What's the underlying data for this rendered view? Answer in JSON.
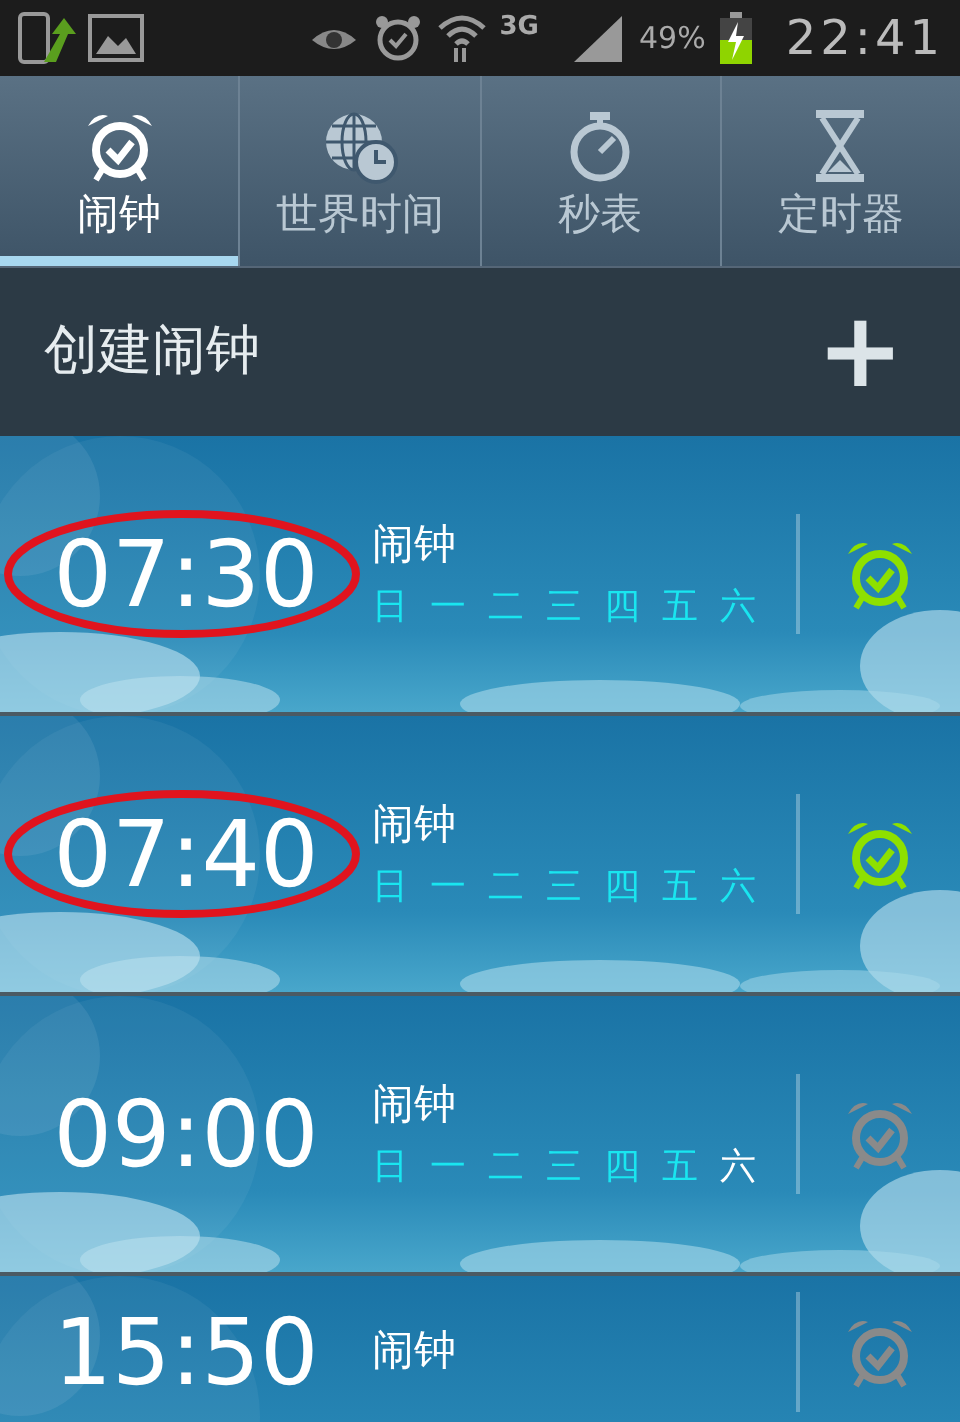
{
  "status_bar": {
    "network": "3G",
    "battery": "49%",
    "time": "22:41"
  },
  "tabs": [
    {
      "kind": "alarm",
      "label": "闹钟",
      "selected": true
    },
    {
      "kind": "world",
      "label": "世界时间",
      "selected": false
    },
    {
      "kind": "stopwatch",
      "label": "秒表",
      "selected": false
    },
    {
      "kind": "timer",
      "label": "定时器",
      "selected": false
    }
  ],
  "create_bar": {
    "label": "创建闹钟",
    "button": "+"
  },
  "alarms": [
    {
      "time": "07:30",
      "name": "闹钟",
      "on": true,
      "circled": true,
      "days": [
        {
          "label": "日",
          "selected": true
        },
        {
          "label": "一",
          "selected": true
        },
        {
          "label": "二",
          "selected": true
        },
        {
          "label": "三",
          "selected": true
        },
        {
          "label": "四",
          "selected": true
        },
        {
          "label": "五",
          "selected": true
        },
        {
          "label": "六",
          "selected": true
        }
      ]
    },
    {
      "time": "07:40",
      "name": "闹钟",
      "on": true,
      "circled": true,
      "days": [
        {
          "label": "日",
          "selected": true
        },
        {
          "label": "一",
          "selected": true
        },
        {
          "label": "二",
          "selected": true
        },
        {
          "label": "三",
          "selected": true
        },
        {
          "label": "四",
          "selected": true
        },
        {
          "label": "五",
          "selected": true
        },
        {
          "label": "六",
          "selected": true
        }
      ]
    },
    {
      "time": "09:00",
      "name": "闹钟",
      "on": false,
      "circled": false,
      "days": [
        {
          "label": "日",
          "selected": true
        },
        {
          "label": "一",
          "selected": true
        },
        {
          "label": "二",
          "selected": true
        },
        {
          "label": "三",
          "selected": true
        },
        {
          "label": "四",
          "selected": true
        },
        {
          "label": "五",
          "selected": true
        },
        {
          "label": "六",
          "selected": false
        }
      ]
    },
    {
      "time": "15:50",
      "name": "闹钟",
      "on": false,
      "circled": false
    }
  ]
}
